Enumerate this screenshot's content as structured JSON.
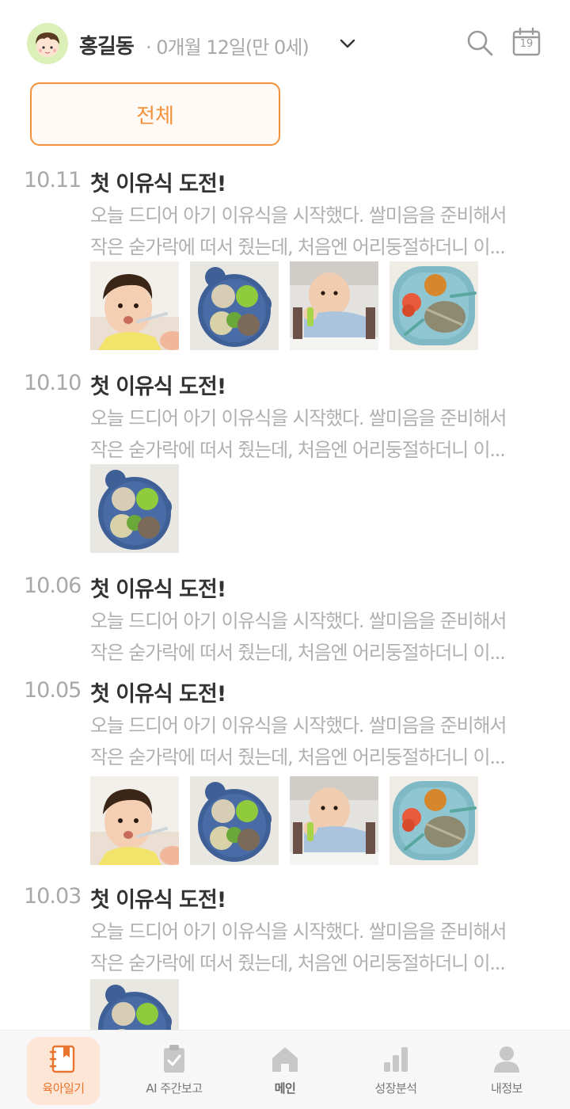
{
  "header": {
    "baby_name": "홍길동",
    "baby_age": "· 0개월 12일(만 0세)",
    "calendar_day": "19",
    "avatar_icon": "baby-face-icon",
    "accent_color": "#f5913a"
  },
  "filter": {
    "label": "전체"
  },
  "entries": [
    {
      "date": "10.11",
      "title": "첫 이유식 도전!",
      "line1": "오늘 드디어 아기 이유식을 시작했다. 쌀미음을 준비해서",
      "line2": "작은 숟가락에 떠서 줬는데, 처음엔 어리둥절하더니 이...",
      "photos": [
        "baby-eating-photo",
        "baby-food-bowl-photo",
        "baby-high-chair-photo",
        "toddler-meal-plate-photo"
      ]
    },
    {
      "date": "10.10",
      "title": "첫 이유식 도전!",
      "line1": "오늘 드디어 아기 이유식을 시작했다. 쌀미음을 준비해서",
      "line2": "작은 숟가락에 떠서 줬는데, 처음엔 어리둥절하더니 이...",
      "photos": [
        "baby-food-bowl-photo"
      ]
    },
    {
      "date": "10.06",
      "title": "첫 이유식 도전!",
      "line1": "오늘 드디어 아기 이유식을 시작했다. 쌀미음을 준비해서",
      "line2": "작은 숟가락에 떠서 줬는데, 처음엔 어리둥절하더니 이...",
      "photos": []
    },
    {
      "date": "10.05",
      "title": "첫 이유식 도전!",
      "line1": "오늘 드디어 아기 이유식을 시작했다. 쌀미음을 준비해서",
      "line2": "작은 숟가락에 떠서 줬는데, 처음엔 어리둥절하더니 이...",
      "photos": [
        "baby-eating-photo",
        "baby-food-bowl-photo",
        "baby-high-chair-photo",
        "toddler-meal-plate-photo"
      ]
    },
    {
      "date": "10.03",
      "title": "첫 이유식 도전!",
      "line1": "오늘 드디어 아기 이유식을 시작했다. 쌀미음을 준비해서",
      "line2": "작은 숟가락에 떠서 줬는데, 처음엔 어리둥절하더니 이...",
      "photos": [
        "baby-food-bowl-photo"
      ]
    }
  ],
  "tabbar": {
    "tabs": [
      {
        "label": "육아일기",
        "icon": "diary-book-icon",
        "active": true
      },
      {
        "label": "AI 주간보고",
        "icon": "clipboard-check-icon",
        "active": false
      },
      {
        "label": "메인",
        "icon": "home-icon",
        "active": false
      },
      {
        "label": "성장분석",
        "icon": "bar-chart-icon",
        "active": false
      },
      {
        "label": "내정보",
        "icon": "person-icon",
        "active": false
      }
    ]
  }
}
